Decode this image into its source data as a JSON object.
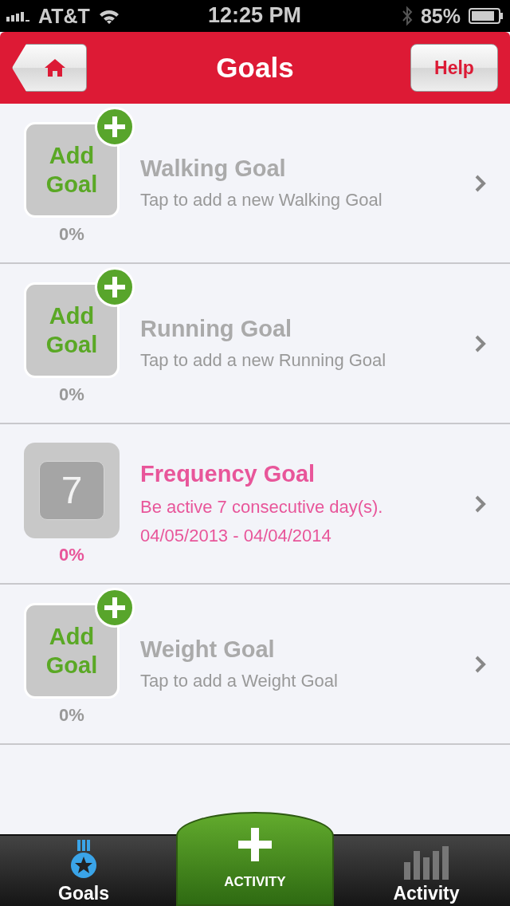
{
  "status_bar": {
    "carrier": "AT&T",
    "time": "12:25 PM",
    "battery": "85%"
  },
  "nav_bar": {
    "title": "Goals",
    "help_button": "Help"
  },
  "goals": [
    {
      "kind": "add",
      "tile_label": "Add Goal",
      "progress": "0%",
      "title": "Walking Goal",
      "lines": [
        "Tap to add a new Walking Goal"
      ]
    },
    {
      "kind": "add",
      "tile_label": "Add Goal",
      "progress": "0%",
      "title": "Running Goal",
      "lines": [
        "Tap to add a new Running Goal"
      ]
    },
    {
      "kind": "active",
      "tile_number": "7",
      "progress": "0%",
      "title": "Frequency Goal",
      "lines": [
        "Be active 7 consecutive day(s).",
        "04/05/2013 - 04/04/2014"
      ]
    },
    {
      "kind": "add",
      "tile_label": "Add Goal",
      "progress": "0%",
      "title": "Weight Goal",
      "lines": [
        "Tap to add a Weight Goal"
      ]
    }
  ],
  "tab_bar": {
    "tabs": [
      {
        "label": "Goals",
        "selected": true
      },
      {
        "label": "Activity",
        "selected": false
      }
    ],
    "center_button": "ACTIVITY"
  }
}
